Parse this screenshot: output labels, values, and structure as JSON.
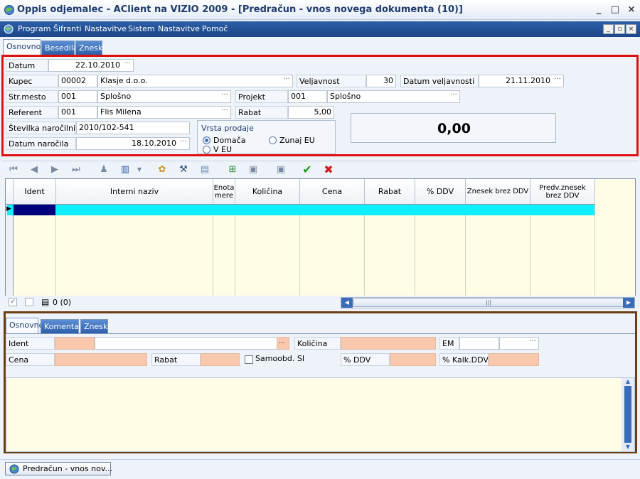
{
  "window": {
    "title": "Oppis odjemalec - AClient na VIZIO 2009 - [Predračun - vnos novega dokumenta (10)]",
    "min": "_",
    "max": "□",
    "close": "×"
  },
  "menu": {
    "items": [
      "Program",
      "Šifranti",
      "Nastavitve",
      "Sistem",
      "Nastavitve",
      "Pomoč"
    ],
    "mdi": [
      "_",
      "▫",
      "×"
    ]
  },
  "top_tabs": [
    "Osnovno",
    "Besedila",
    "Zneski"
  ],
  "header": {
    "datum_label": "Datum",
    "datum": "22.10.2010",
    "kupec_label": "Kupec",
    "kupec_code": "00002",
    "kupec_name": "Klasje d.o.o.",
    "veljavnost_label": "Veljavnost",
    "veljavnost": "30",
    "datum_velj_label": "Datum veljavnosti",
    "datum_velj": "21.11.2010",
    "strmesto_label": "Str.mesto",
    "strmesto_code": "001",
    "strmesto_name": "Splošno",
    "projekt_label": "Projekt",
    "projekt_code": "001",
    "projekt_name": "Splošno",
    "referent_label": "Referent",
    "referent_code": "001",
    "referent_name": "Flis Milena",
    "rabat_label": "Rabat",
    "rabat": "5,00",
    "narocilnica_label": "Številka naročilnice",
    "narocilnica": "2010/102-541",
    "datum_narocila_label": "Datum naročila",
    "datum_narocila": "18.10.2010",
    "vrsta_label": "Vrsta prodaje",
    "vrsta_domaca": "Domača",
    "vrsta_zunaj": "Zunaj EU",
    "vrsta_veu": "V EU",
    "total": "0,00"
  },
  "grid": {
    "columns": [
      "Ident",
      "Interni naziv",
      "Enota mere",
      "Količina",
      "Cena",
      "Rabat",
      "% DDV",
      "Znesek brez DDV",
      "Predv.znesek brez DDV"
    ],
    "record_count": "0 (0)"
  },
  "bottom_tabs": [
    "Osnovno",
    "Komentar",
    "Zneski"
  ],
  "detail": {
    "ident": "Ident",
    "kolicina": "Količina",
    "em": "EM",
    "cena": "Cena",
    "rabat": "Rabat",
    "samoobd": "Samoobd. SI",
    "ddv": "% DDV",
    "kalk_ddv": "% Kalk.DDV"
  },
  "taskbar": {
    "button": "Predračun - vnos nov..."
  }
}
